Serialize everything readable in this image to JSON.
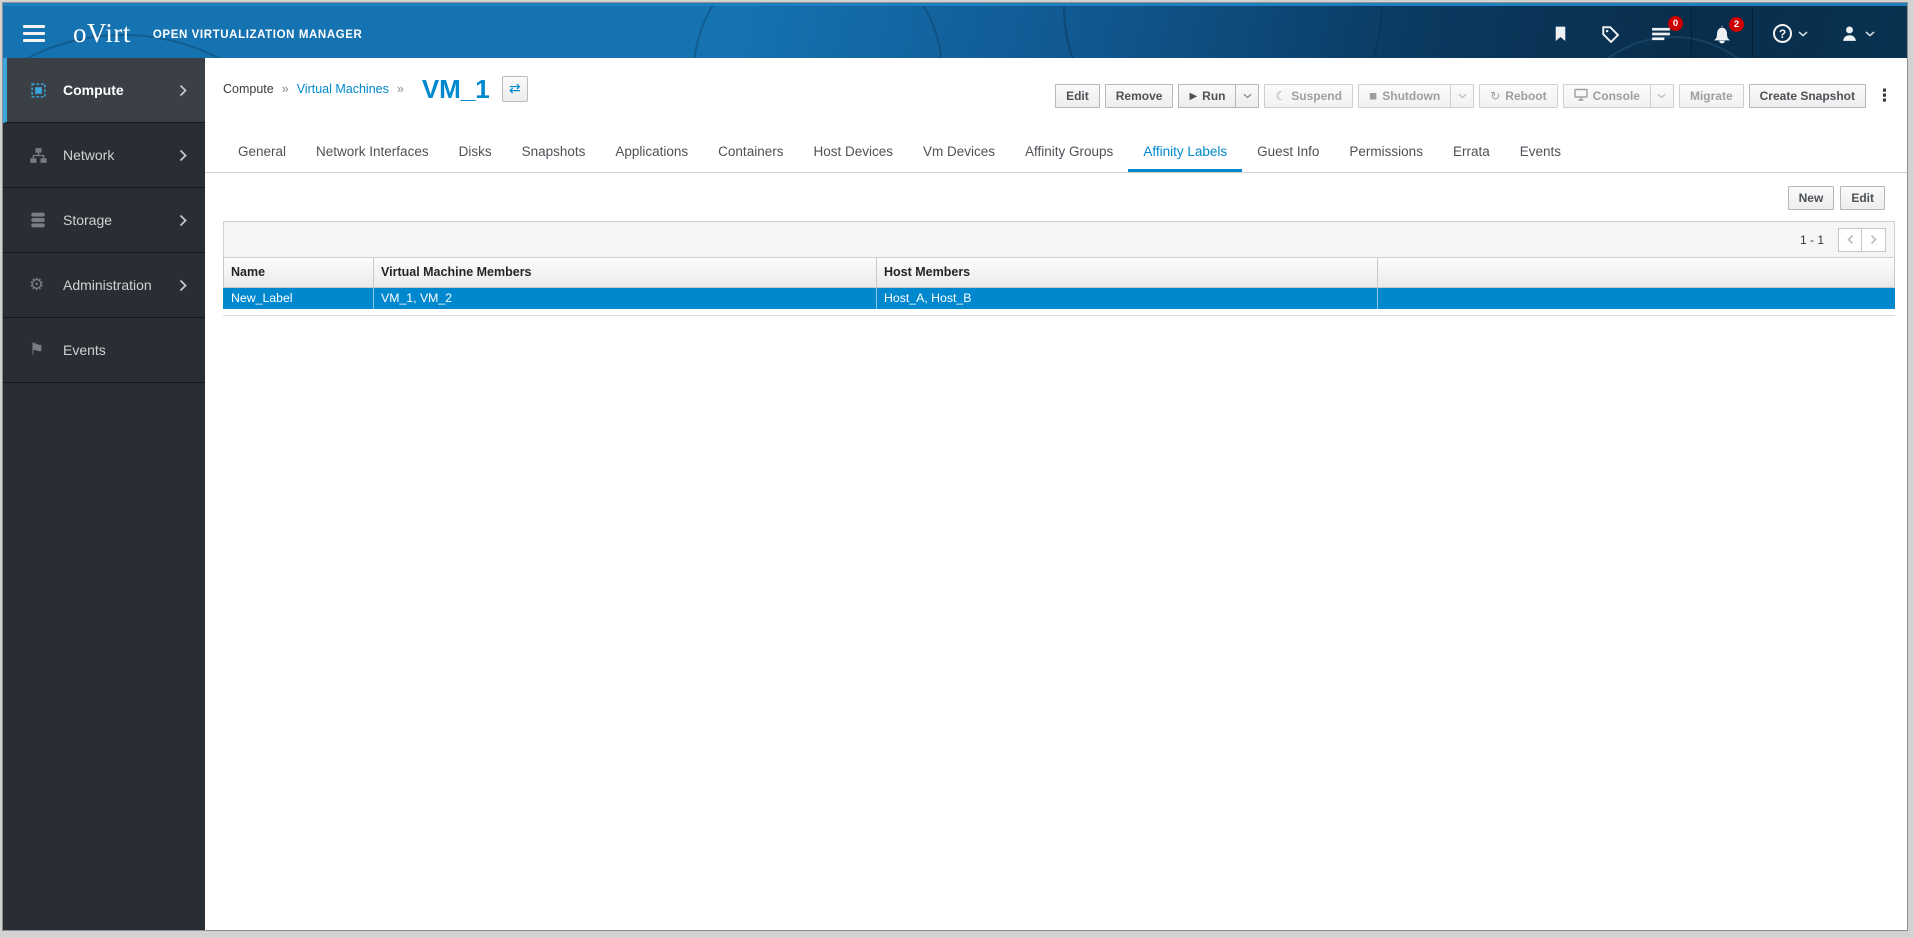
{
  "masthead": {
    "brand": "oVirt",
    "product": "OPEN VIRTUALIZATION MANAGER",
    "tasks_badge": "0",
    "alerts_badge": "2"
  },
  "sidebar": {
    "items": [
      {
        "label": "Compute",
        "active": true
      },
      {
        "label": "Network",
        "active": false
      },
      {
        "label": "Storage",
        "active": false
      },
      {
        "label": "Administration",
        "active": false
      },
      {
        "label": "Events",
        "active": false
      }
    ]
  },
  "breadcrumb": {
    "root": "Compute",
    "section": "Virtual Machines",
    "separator": "»",
    "title": "VM_1"
  },
  "actions": {
    "edit": "Edit",
    "remove": "Remove",
    "run": "Run",
    "suspend": "Suspend",
    "shutdown": "Shutdown",
    "reboot": "Reboot",
    "console": "Console",
    "migrate": "Migrate",
    "create_snapshot": "Create Snapshot"
  },
  "tabs": {
    "items": [
      {
        "label": "General"
      },
      {
        "label": "Network Interfaces"
      },
      {
        "label": "Disks"
      },
      {
        "label": "Snapshots"
      },
      {
        "label": "Applications"
      },
      {
        "label": "Containers"
      },
      {
        "label": "Host Devices"
      },
      {
        "label": "Vm Devices"
      },
      {
        "label": "Affinity Groups"
      },
      {
        "label": "Affinity Labels",
        "active": true
      },
      {
        "label": "Guest Info"
      },
      {
        "label": "Permissions"
      },
      {
        "label": "Errata"
      },
      {
        "label": "Events"
      }
    ]
  },
  "list_actions": {
    "new": "New",
    "edit": "Edit"
  },
  "pagination": {
    "range": "1 - 1"
  },
  "table": {
    "columns": [
      "Name",
      "Virtual Machine Members",
      "Host Members",
      ""
    ],
    "rows": [
      {
        "name": "New_Label",
        "vm_members": "VM_1, VM_2",
        "host_members": "Host_A, Host_B"
      }
    ]
  },
  "icons": {
    "play": "▶",
    "stop": "◼",
    "moon": "☾",
    "reboot": "↻",
    "switch": "⇄",
    "kebab": "⋮",
    "gear": "⚙",
    "flag": "⚑",
    "help": "?"
  },
  "colors": {
    "accent": "#0088ce",
    "masthead_left": "#1673b2",
    "masthead_right": "#083150",
    "sidebar_bg": "#292e34",
    "sidebar_active_accent": "#39a5dc",
    "selected_row": "#0088ce",
    "badge": "#cc0000",
    "disabled_text": "#9c9fa1"
  }
}
